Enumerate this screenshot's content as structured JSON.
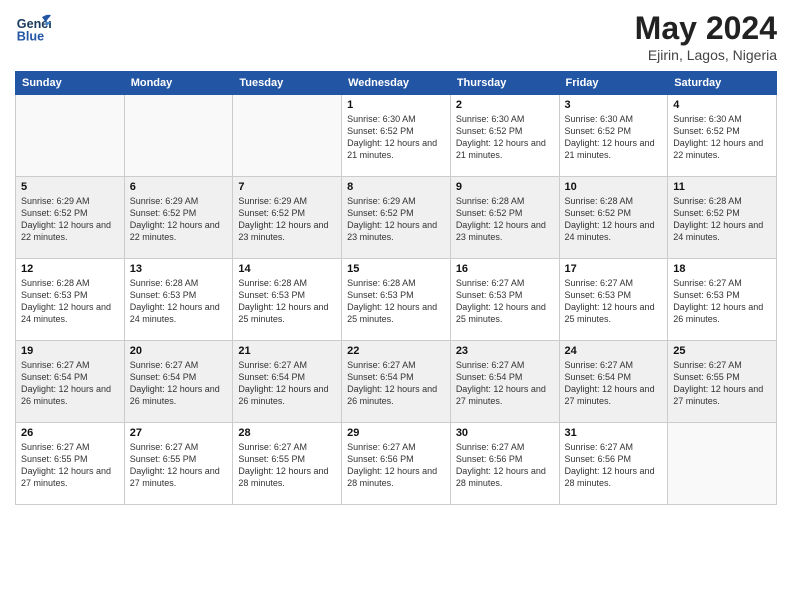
{
  "header": {
    "logo_line1": "General",
    "logo_line2": "Blue",
    "main_title": "May 2024",
    "subtitle": "Ejirin, Lagos, Nigeria"
  },
  "weekdays": [
    "Sunday",
    "Monday",
    "Tuesday",
    "Wednesday",
    "Thursday",
    "Friday",
    "Saturday"
  ],
  "weeks": [
    [
      {
        "day": "",
        "info": ""
      },
      {
        "day": "",
        "info": ""
      },
      {
        "day": "",
        "info": ""
      },
      {
        "day": "1",
        "info": "Sunrise: 6:30 AM\nSunset: 6:52 PM\nDaylight: 12 hours\nand 21 minutes."
      },
      {
        "day": "2",
        "info": "Sunrise: 6:30 AM\nSunset: 6:52 PM\nDaylight: 12 hours\nand 21 minutes."
      },
      {
        "day": "3",
        "info": "Sunrise: 6:30 AM\nSunset: 6:52 PM\nDaylight: 12 hours\nand 21 minutes."
      },
      {
        "day": "4",
        "info": "Sunrise: 6:30 AM\nSunset: 6:52 PM\nDaylight: 12 hours\nand 22 minutes."
      }
    ],
    [
      {
        "day": "5",
        "info": "Sunrise: 6:29 AM\nSunset: 6:52 PM\nDaylight: 12 hours\nand 22 minutes."
      },
      {
        "day": "6",
        "info": "Sunrise: 6:29 AM\nSunset: 6:52 PM\nDaylight: 12 hours\nand 22 minutes."
      },
      {
        "day": "7",
        "info": "Sunrise: 6:29 AM\nSunset: 6:52 PM\nDaylight: 12 hours\nand 23 minutes."
      },
      {
        "day": "8",
        "info": "Sunrise: 6:29 AM\nSunset: 6:52 PM\nDaylight: 12 hours\nand 23 minutes."
      },
      {
        "day": "9",
        "info": "Sunrise: 6:28 AM\nSunset: 6:52 PM\nDaylight: 12 hours\nand 23 minutes."
      },
      {
        "day": "10",
        "info": "Sunrise: 6:28 AM\nSunset: 6:52 PM\nDaylight: 12 hours\nand 24 minutes."
      },
      {
        "day": "11",
        "info": "Sunrise: 6:28 AM\nSunset: 6:52 PM\nDaylight: 12 hours\nand 24 minutes."
      }
    ],
    [
      {
        "day": "12",
        "info": "Sunrise: 6:28 AM\nSunset: 6:53 PM\nDaylight: 12 hours\nand 24 minutes."
      },
      {
        "day": "13",
        "info": "Sunrise: 6:28 AM\nSunset: 6:53 PM\nDaylight: 12 hours\nand 24 minutes."
      },
      {
        "day": "14",
        "info": "Sunrise: 6:28 AM\nSunset: 6:53 PM\nDaylight: 12 hours\nand 25 minutes."
      },
      {
        "day": "15",
        "info": "Sunrise: 6:28 AM\nSunset: 6:53 PM\nDaylight: 12 hours\nand 25 minutes."
      },
      {
        "day": "16",
        "info": "Sunrise: 6:27 AM\nSunset: 6:53 PM\nDaylight: 12 hours\nand 25 minutes."
      },
      {
        "day": "17",
        "info": "Sunrise: 6:27 AM\nSunset: 6:53 PM\nDaylight: 12 hours\nand 25 minutes."
      },
      {
        "day": "18",
        "info": "Sunrise: 6:27 AM\nSunset: 6:53 PM\nDaylight: 12 hours\nand 26 minutes."
      }
    ],
    [
      {
        "day": "19",
        "info": "Sunrise: 6:27 AM\nSunset: 6:54 PM\nDaylight: 12 hours\nand 26 minutes."
      },
      {
        "day": "20",
        "info": "Sunrise: 6:27 AM\nSunset: 6:54 PM\nDaylight: 12 hours\nand 26 minutes."
      },
      {
        "day": "21",
        "info": "Sunrise: 6:27 AM\nSunset: 6:54 PM\nDaylight: 12 hours\nand 26 minutes."
      },
      {
        "day": "22",
        "info": "Sunrise: 6:27 AM\nSunset: 6:54 PM\nDaylight: 12 hours\nand 26 minutes."
      },
      {
        "day": "23",
        "info": "Sunrise: 6:27 AM\nSunset: 6:54 PM\nDaylight: 12 hours\nand 27 minutes."
      },
      {
        "day": "24",
        "info": "Sunrise: 6:27 AM\nSunset: 6:54 PM\nDaylight: 12 hours\nand 27 minutes."
      },
      {
        "day": "25",
        "info": "Sunrise: 6:27 AM\nSunset: 6:55 PM\nDaylight: 12 hours\nand 27 minutes."
      }
    ],
    [
      {
        "day": "26",
        "info": "Sunrise: 6:27 AM\nSunset: 6:55 PM\nDaylight: 12 hours\nand 27 minutes."
      },
      {
        "day": "27",
        "info": "Sunrise: 6:27 AM\nSunset: 6:55 PM\nDaylight: 12 hours\nand 27 minutes."
      },
      {
        "day": "28",
        "info": "Sunrise: 6:27 AM\nSunset: 6:55 PM\nDaylight: 12 hours\nand 28 minutes."
      },
      {
        "day": "29",
        "info": "Sunrise: 6:27 AM\nSunset: 6:56 PM\nDaylight: 12 hours\nand 28 minutes."
      },
      {
        "day": "30",
        "info": "Sunrise: 6:27 AM\nSunset: 6:56 PM\nDaylight: 12 hours\nand 28 minutes."
      },
      {
        "day": "31",
        "info": "Sunrise: 6:27 AM\nSunset: 6:56 PM\nDaylight: 12 hours\nand 28 minutes."
      },
      {
        "day": "",
        "info": ""
      }
    ]
  ]
}
